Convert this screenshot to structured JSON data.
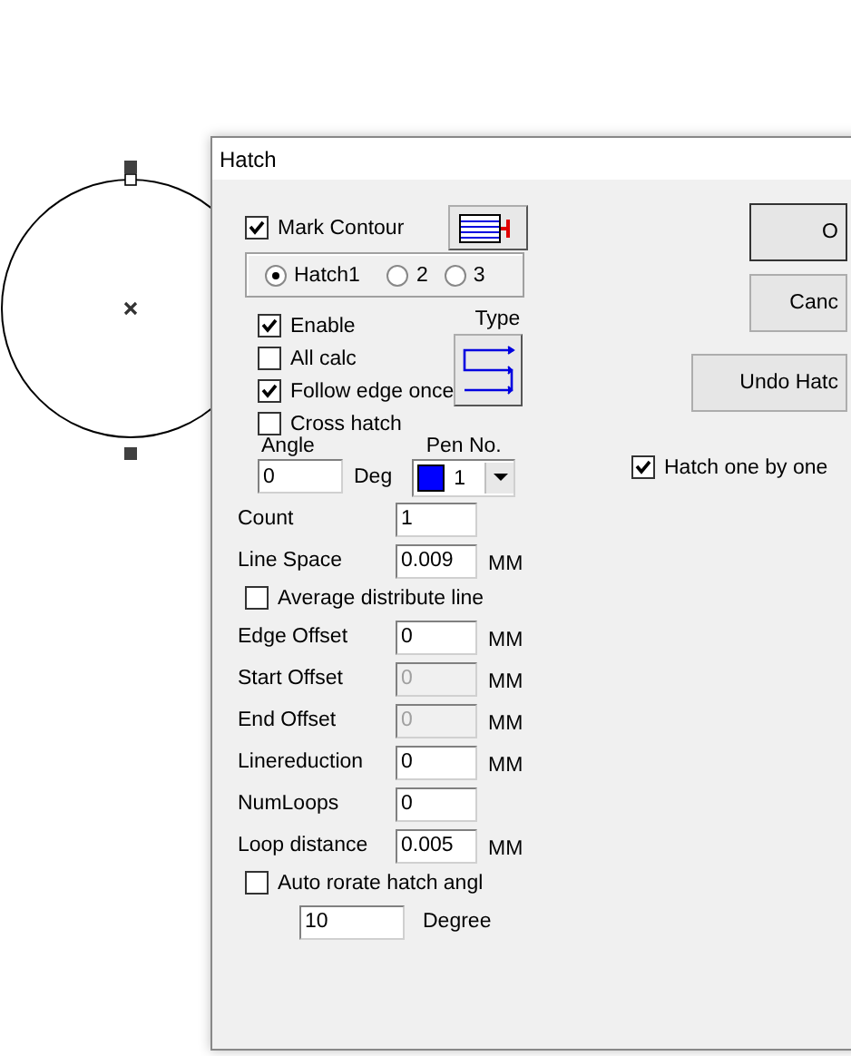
{
  "dialog": {
    "title": "Hatch"
  },
  "mark_contour": {
    "label": "Mark Contour",
    "checked": true
  },
  "hatch_tabs": [
    {
      "label": "Hatch1",
      "selected": true
    },
    {
      "label": "2",
      "selected": false
    },
    {
      "label": "3",
      "selected": false
    }
  ],
  "options": [
    {
      "label": "Enable",
      "checked": true
    },
    {
      "label": "All calc",
      "checked": false
    },
    {
      "label": "Follow edge once",
      "checked": true
    },
    {
      "label": "Cross hatch",
      "checked": false
    }
  ],
  "type_label": "Type",
  "angle": {
    "label": "Angle",
    "value": "0",
    "unit": "Deg"
  },
  "pen": {
    "label": "Pen No.",
    "value": "1"
  },
  "rows": [
    {
      "kind": "field",
      "label": "Count",
      "value": "1",
      "unit": "",
      "disabled": false
    },
    {
      "kind": "field",
      "label": "Line Space",
      "value": "0.009",
      "unit": "MM",
      "disabled": false
    },
    {
      "kind": "checkbox",
      "label": "Average distribute line",
      "checked": false
    },
    {
      "kind": "field",
      "label": "Edge Offset",
      "value": "0",
      "unit": "MM",
      "disabled": false
    },
    {
      "kind": "field",
      "label": "Start Offset",
      "value": "0",
      "unit": "MM",
      "disabled": true
    },
    {
      "kind": "field",
      "label": "End Offset",
      "value": "0",
      "unit": "MM",
      "disabled": true
    },
    {
      "kind": "field",
      "label": "Linereduction",
      "value": "0",
      "unit": "MM",
      "disabled": false
    },
    {
      "kind": "field",
      "label": "NumLoops",
      "value": "0",
      "unit": "",
      "disabled": false
    },
    {
      "kind": "field",
      "label": "Loop distance",
      "value": "0.005",
      "unit": "MM",
      "disabled": false
    },
    {
      "kind": "checkbox",
      "label": "Auto rorate hatch angl",
      "checked": false
    },
    {
      "kind": "step",
      "value": "10",
      "unit": "Degree",
      "disabled": false
    }
  ],
  "buttons": [
    {
      "label": "O"
    },
    {
      "label": "Canc"
    },
    {
      "label": "Undo Hatc"
    }
  ],
  "hatch_one_by_one": {
    "label": "Hatch one by one",
    "checked": true
  }
}
